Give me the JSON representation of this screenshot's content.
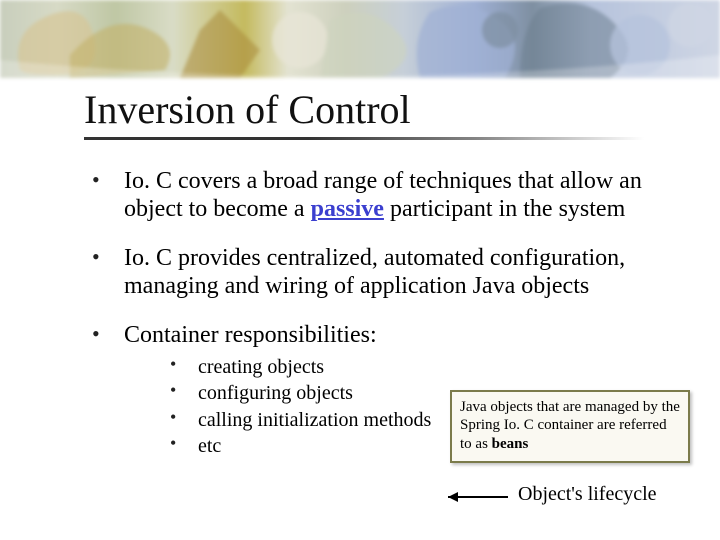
{
  "title": "Inversion of Control",
  "bullets": {
    "b1_pre": "Io. C covers a broad range of techniques that allow an object to become a ",
    "b1_emph": "passive",
    "b1_post": " participant in the system",
    "b2": "Io. C provides centralized, automated configuration, managing and wiring of application Java objects",
    "b3": "Container responsibilities:"
  },
  "sub": {
    "s1": "creating objects",
    "s2": "configuring objects",
    "s3": "calling initialization methods",
    "s4": "etc"
  },
  "callout": {
    "line_pre": "Java objects that are managed by the Spring Io. C container are referred to as ",
    "bold": "beans"
  },
  "lifecycle": "Object's lifecycle"
}
